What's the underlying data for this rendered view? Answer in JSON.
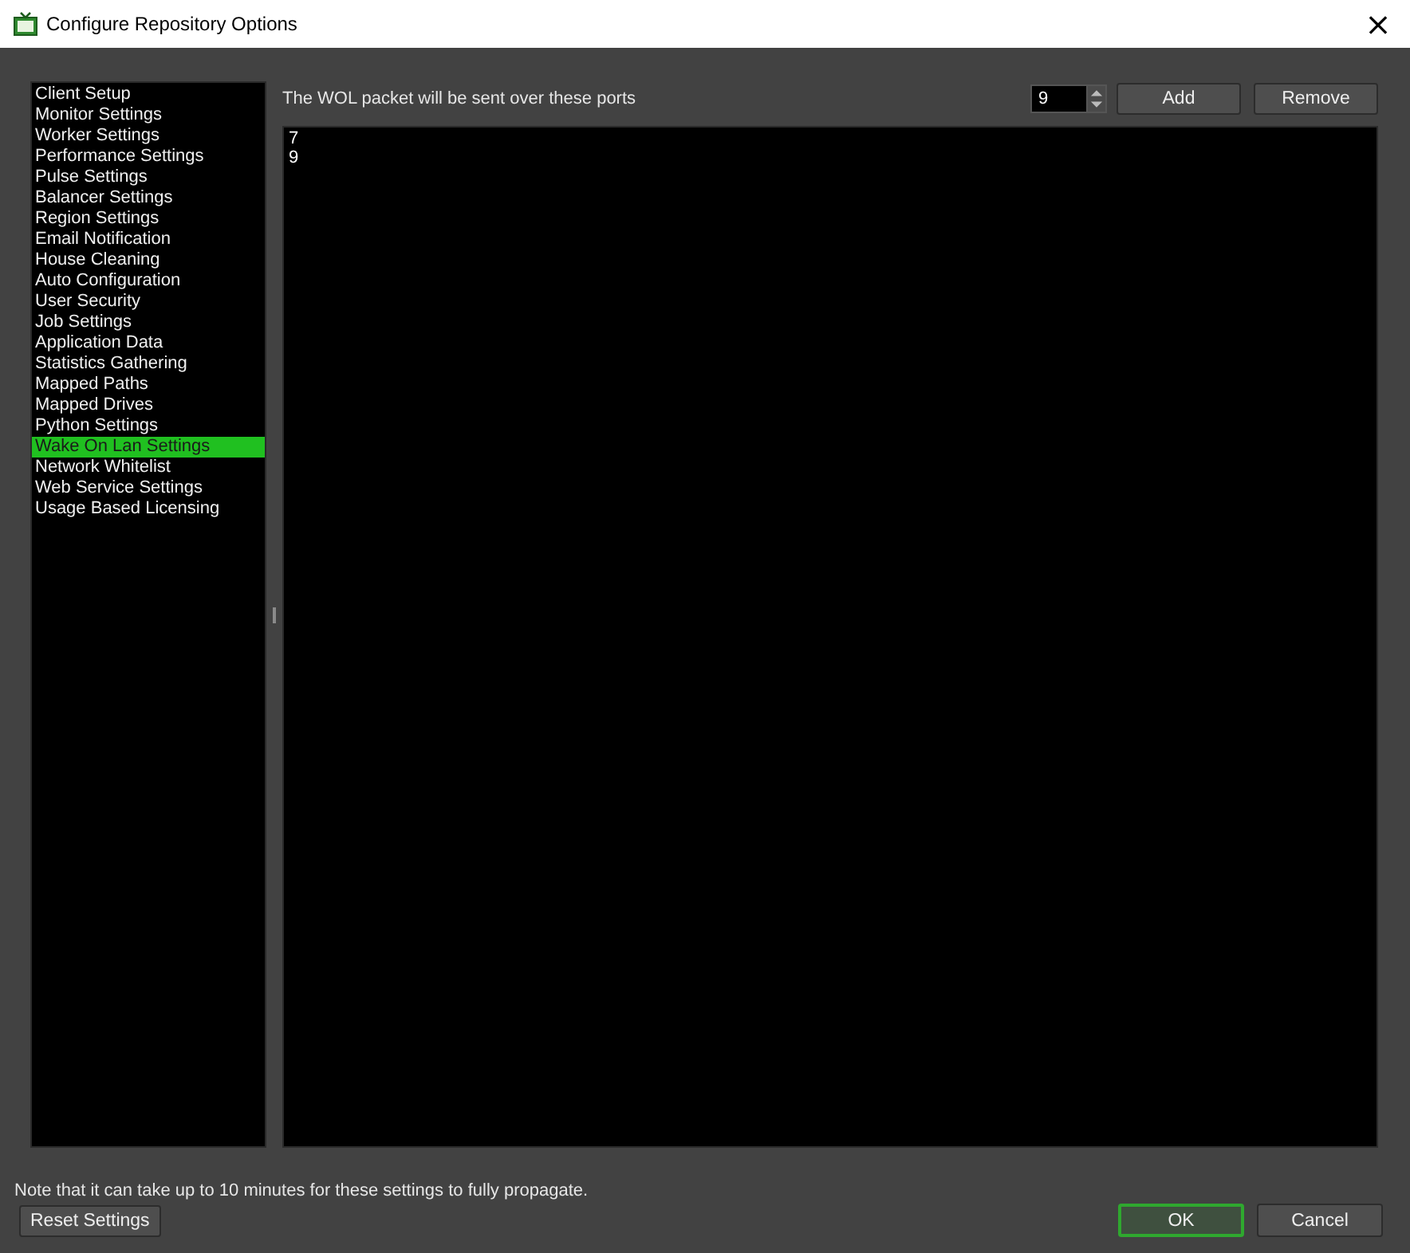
{
  "window": {
    "title": "Configure Repository Options",
    "close": "×"
  },
  "sidebar": {
    "items": [
      {
        "label": "Client Setup",
        "selected": false
      },
      {
        "label": "Monitor Settings",
        "selected": false
      },
      {
        "label": "Worker Settings",
        "selected": false
      },
      {
        "label": "Performance Settings",
        "selected": false
      },
      {
        "label": "Pulse Settings",
        "selected": false
      },
      {
        "label": "Balancer Settings",
        "selected": false
      },
      {
        "label": "Region Settings",
        "selected": false
      },
      {
        "label": "Email Notification",
        "selected": false
      },
      {
        "label": "House Cleaning",
        "selected": false
      },
      {
        "label": "Auto Configuration",
        "selected": false
      },
      {
        "label": "User Security",
        "selected": false
      },
      {
        "label": "Job Settings",
        "selected": false
      },
      {
        "label": "Application Data",
        "selected": false
      },
      {
        "label": "Statistics Gathering",
        "selected": false
      },
      {
        "label": "Mapped Paths",
        "selected": false
      },
      {
        "label": "Mapped Drives",
        "selected": false
      },
      {
        "label": "Python Settings",
        "selected": false
      },
      {
        "label": "Wake On Lan Settings",
        "selected": true
      },
      {
        "label": "Network Whitelist",
        "selected": false
      },
      {
        "label": "Web Service Settings",
        "selected": false
      },
      {
        "label": "Usage Based Licensing",
        "selected": false
      }
    ]
  },
  "ports": {
    "description": "The WOL packet will be sent over these ports",
    "spin_value": "9",
    "buttons": [
      "Add",
      "Remove"
    ],
    "list": [
      "7",
      "9"
    ]
  },
  "note": "Note that it can take up to 10 minutes for these settings to fully propagate.",
  "reset_button": "Reset Settings",
  "dialog_buttons": [
    {
      "label": "OK",
      "default": true
    },
    {
      "label": "Cancel",
      "default": false
    }
  ]
}
